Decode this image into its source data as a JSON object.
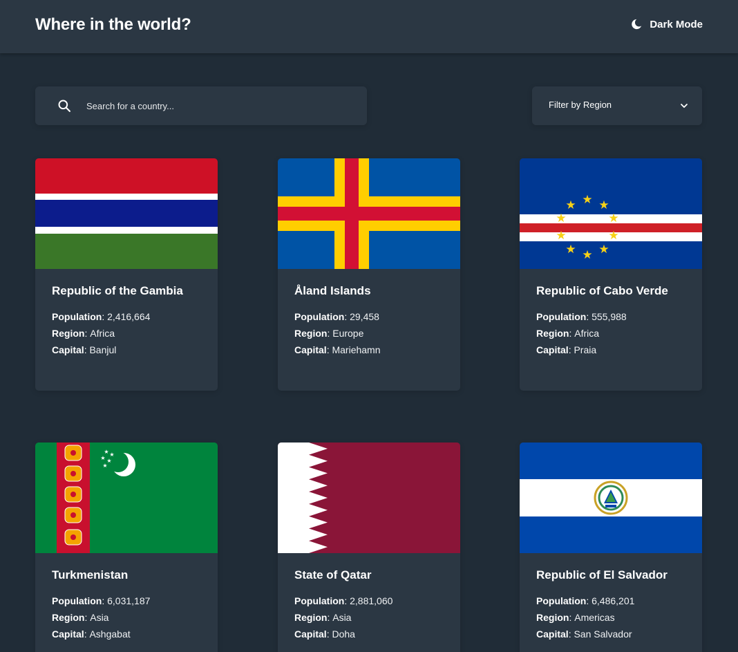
{
  "header": {
    "title": "Where in the world?",
    "mode_label": "Dark Mode"
  },
  "controls": {
    "search_placeholder": "Search for a country...",
    "filter_label": "Filter by Region"
  },
  "field_labels": {
    "population": "Population",
    "region": "Region",
    "capital": "Capital"
  },
  "countries": [
    {
      "name": "Republic of the Gambia",
      "population": "2,416,664",
      "region": "Africa",
      "capital": "Banjul",
      "flag_icon": "gambia-flag"
    },
    {
      "name": "Åland Islands",
      "population": "29,458",
      "region": "Europe",
      "capital": "Mariehamn",
      "flag_icon": "aland-flag"
    },
    {
      "name": "Republic of Cabo Verde",
      "population": "555,988",
      "region": "Africa",
      "capital": "Praia",
      "flag_icon": "cabo-verde-flag"
    },
    {
      "name": "Turkmenistan",
      "population": "6,031,187",
      "region": "Asia",
      "capital": "Ashgabat",
      "flag_icon": "turkmenistan-flag"
    },
    {
      "name": "State of Qatar",
      "population": "2,881,060",
      "region": "Asia",
      "capital": "Doha",
      "flag_icon": "qatar-flag"
    },
    {
      "name": "Republic of El Salvador",
      "population": "6,486,201",
      "region": "Americas",
      "capital": "San Salvador",
      "flag_icon": "el-salvador-flag"
    }
  ],
  "colors": {
    "background": "#202c37",
    "element": "#2b3743",
    "text": "#ffffff"
  }
}
